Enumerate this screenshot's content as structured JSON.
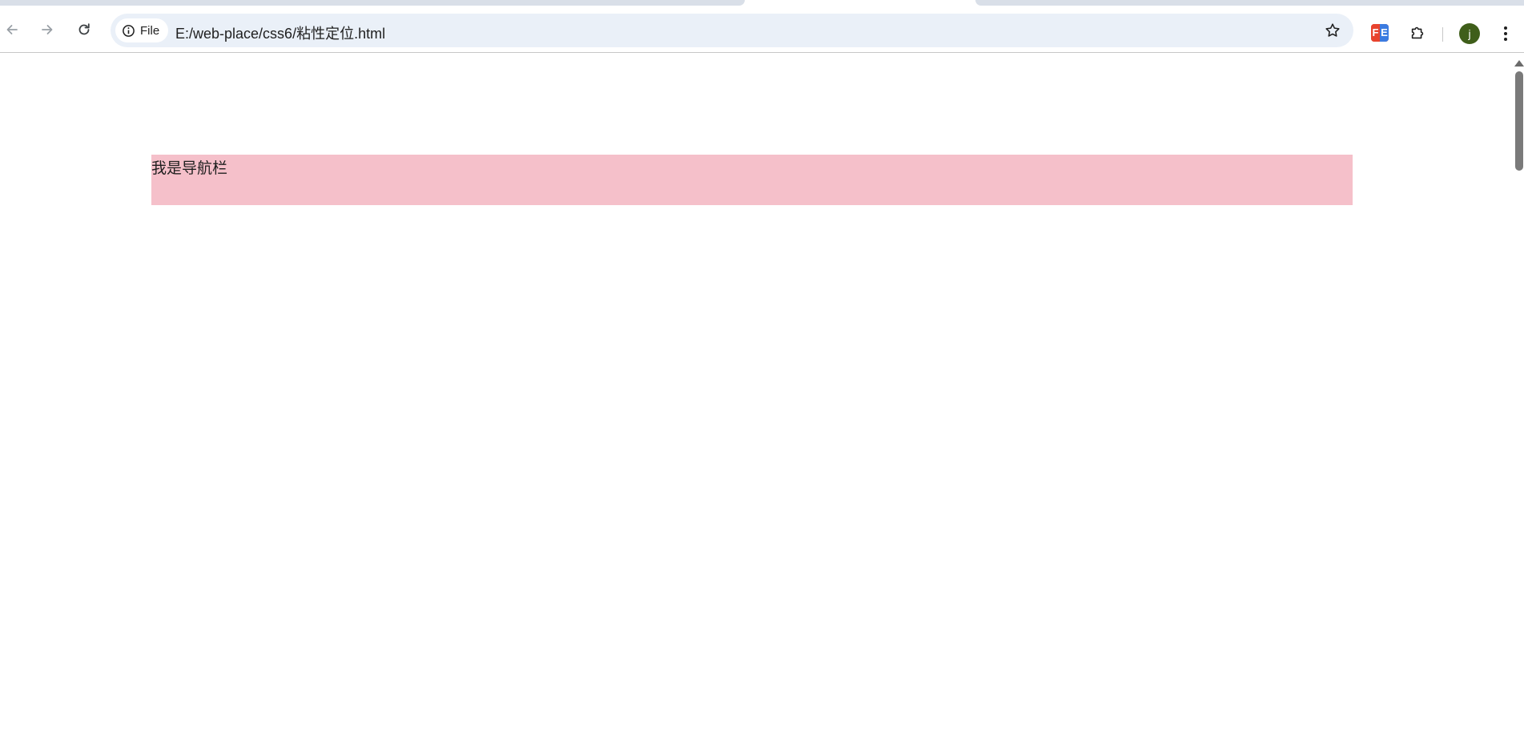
{
  "browser": {
    "address_chip_label": "File",
    "url": "E:/web-place/css6/粘性定位.html",
    "avatar_initial": "j",
    "extension_letters": [
      "F",
      "E"
    ],
    "icons": {
      "back": "arrow-left-icon",
      "forward": "arrow-right-icon",
      "reload": "reload-icon",
      "site_info": "info-icon",
      "bookmark": "star-icon",
      "extensions": "puzzle-icon",
      "menu": "kebab-menu-icon"
    }
  },
  "page": {
    "navbar_text": "我是导航栏",
    "colors": {
      "navbar_background": "#f5c0ca",
      "avatar_background": "#3f5e1a",
      "omnibox_background": "#eaf0f8"
    }
  }
}
